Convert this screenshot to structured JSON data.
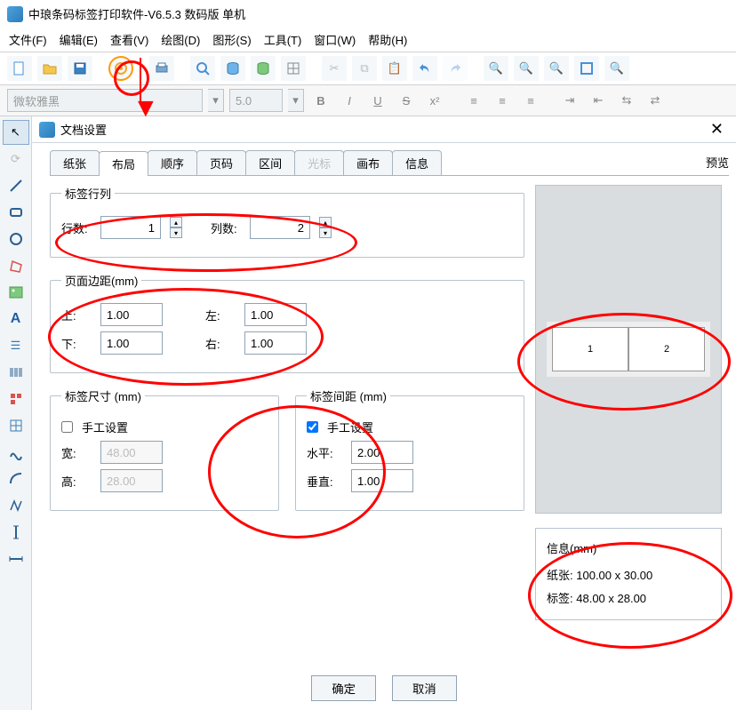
{
  "app": {
    "title": "中琅条码标签打印软件-V6.5.3 数码版 单机"
  },
  "menu": {
    "file": "文件(F)",
    "edit": "编辑(E)",
    "view": "查看(V)",
    "draw": "绘图(D)",
    "shape": "图形(S)",
    "tools": "工具(T)",
    "window": "窗口(W)",
    "help": "帮助(H)"
  },
  "format": {
    "font": "微软雅黑",
    "size": "5.0"
  },
  "dialog": {
    "title": "文档设置",
    "tabs": {
      "paper": "纸张",
      "layout": "布局",
      "order": "顺序",
      "page": "页码",
      "region": "区间",
      "cursor": "光标",
      "canvas": "画布",
      "info": "信息"
    },
    "preview_label": "预览",
    "rowscols": {
      "legend": "标签行列",
      "rows_label": "行数:",
      "rows": "1",
      "cols_label": "列数:",
      "cols": "2"
    },
    "margins": {
      "legend": "页面边距(mm)",
      "top_label": "上:",
      "top": "1.00",
      "left_label": "左:",
      "left": "1.00",
      "bottom_label": "下:",
      "bottom": "1.00",
      "right_label": "右:",
      "right": "1.00"
    },
    "size": {
      "legend": "标签尺寸 (mm)",
      "manual_label": "手工设置",
      "width_label": "宽:",
      "width": "48.00",
      "height_label": "高:",
      "height": "28.00"
    },
    "spacing": {
      "legend": "标签间距 (mm)",
      "manual_label": "手工设置",
      "h_label": "水平:",
      "h": "2.00",
      "v_label": "垂直:",
      "v": "1.00"
    },
    "info": {
      "legend": "信息(mm)",
      "paper_label": "纸张:",
      "paper": "100.00 x 30.00",
      "label_label": "标签:",
      "label": "48.00 x 28.00"
    },
    "pv": {
      "c1": "1",
      "c2": "2"
    },
    "ok": "确定",
    "cancel": "取消"
  }
}
